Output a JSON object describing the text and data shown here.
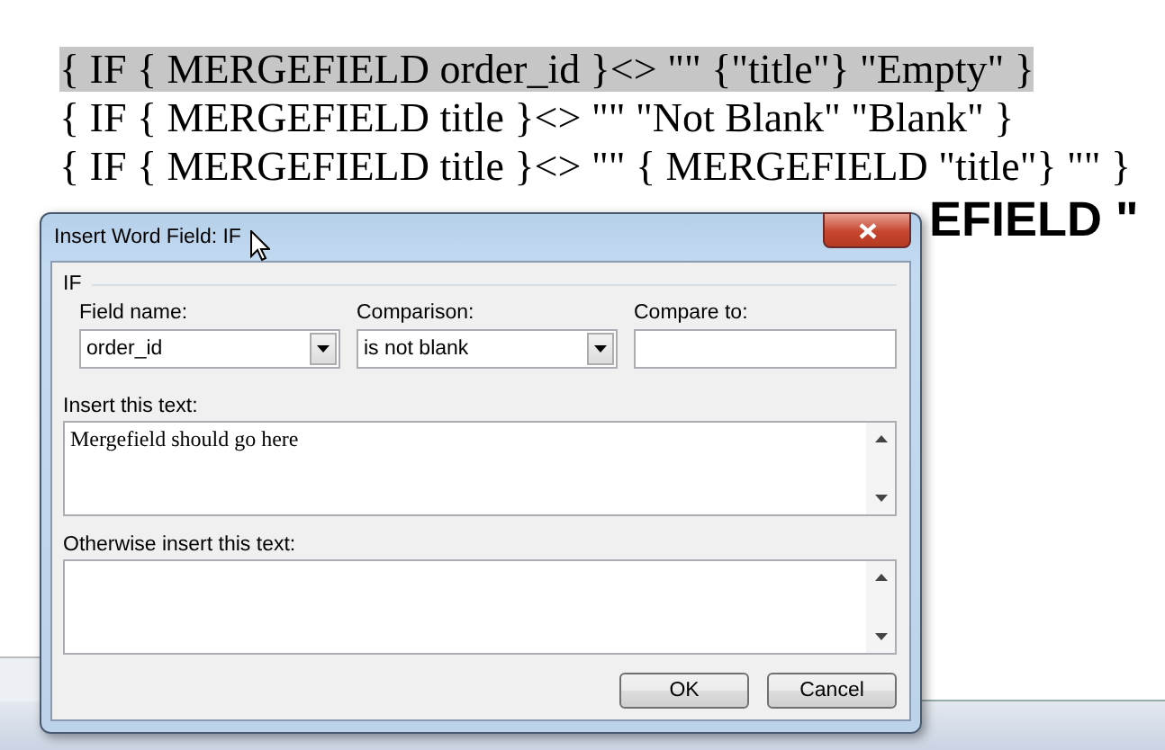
{
  "document": {
    "lines": [
      {
        "text": "{ IF { MERGEFIELD order_id }<> \"\" {\"title\"} \"Empty\" }",
        "highlighted": true,
        "bold": false,
        "kind": "full"
      },
      {
        "text": "{ IF { MERGEFIELD title }<> \"\" \"Not Blank\" \"Blank\" }",
        "highlighted": false,
        "bold": false,
        "kind": "full"
      },
      {
        "text": "{ IF { MERGEFIELD title }<> \"\" { MERGEFIELD \"title\"} \"\" }",
        "highlighted": false,
        "bold": false,
        "kind": "full"
      },
      {
        "text": "EFIELD \"",
        "highlighted": false,
        "bold": true,
        "kind": "obscured"
      }
    ]
  },
  "dialog": {
    "title": "Insert Word Field: IF",
    "group": "IF",
    "field_name": {
      "label": "Field name:",
      "value": "order_id"
    },
    "comparison": {
      "label": "Comparison:",
      "value": "is not blank"
    },
    "compare_to": {
      "label": "Compare to:"
    },
    "insert_text": {
      "label": "Insert this text:",
      "value": "Mergefield should go here"
    },
    "otherwise_text": {
      "label": "Otherwise insert this text:"
    },
    "buttons": [
      "OK",
      "Cancel"
    ]
  }
}
